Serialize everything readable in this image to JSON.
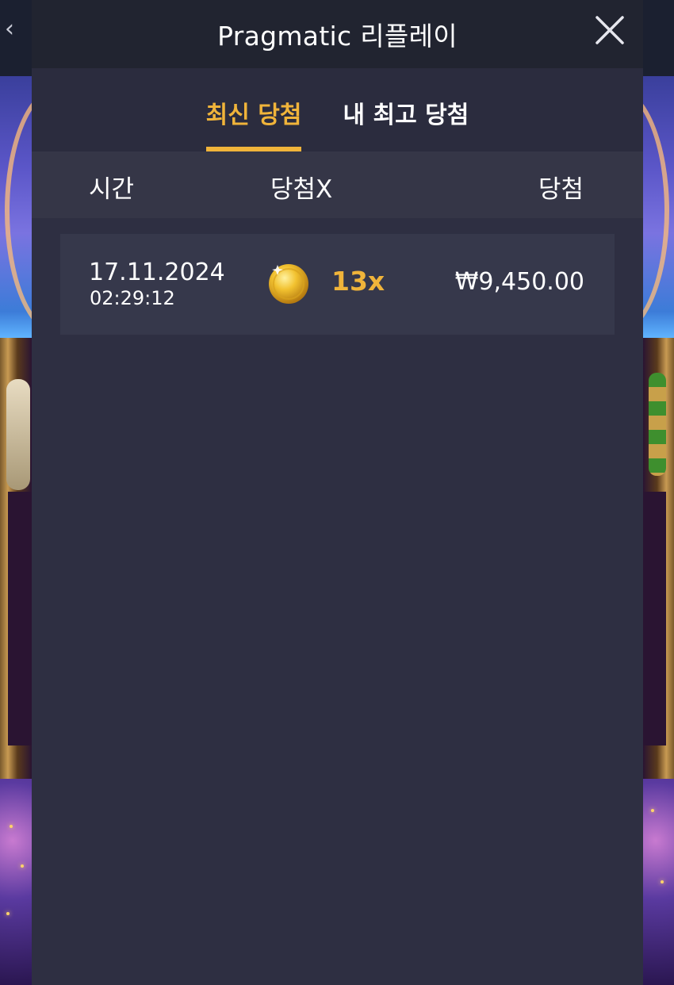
{
  "header": {
    "title": "Pragmatic 리플레이",
    "close_icon": "close-icon",
    "back_icon": "chevron-left-icon"
  },
  "tabs": [
    {
      "label": "최신 당첨",
      "active": true
    },
    {
      "label": "내 최고 당첨",
      "active": false
    }
  ],
  "columns": {
    "time": "시간",
    "multiplier": "당첨X",
    "win": "당첨"
  },
  "rows": [
    {
      "date": "17.11.2024",
      "time": "02:29:12",
      "icon": "coin-icon",
      "multiplier": "13x",
      "amount": "₩9,450.00"
    }
  ],
  "colors": {
    "accent": "#f0b43a",
    "modal_bg": "#2e2f42",
    "header_bg": "#212430",
    "column_header_bg": "#353647",
    "row_bg": "#36384b"
  }
}
